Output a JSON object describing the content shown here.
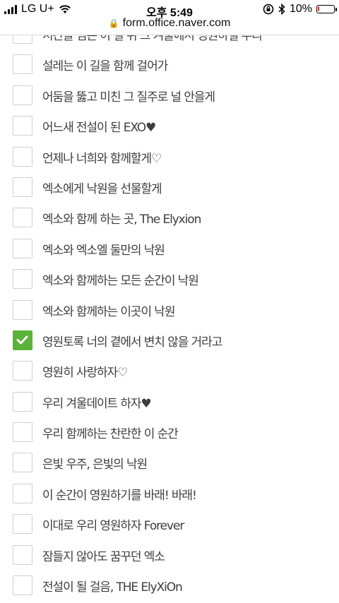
{
  "status_bar": {
    "carrier": "LG U+",
    "time": "오후 5:49",
    "battery_percent": "10%",
    "battery_level": 0.1
  },
  "browser": {
    "url": "form.office.naver.com"
  },
  "options": [
    {
      "label": "시간을 넘은 이 길 위 그 겨울에서 영원하길 우리",
      "checked": false
    },
    {
      "label": "설레는 이 길을 함께 걸어가",
      "checked": false
    },
    {
      "label": "어둠을 뚫고 미친 그 질주로 널 안을게",
      "checked": false
    },
    {
      "label": "어느새 전설이 된 EXO♥",
      "checked": false
    },
    {
      "label": "언제나 너희와 함께할게♡",
      "checked": false
    },
    {
      "label": "엑소에게 낙원을 선물할게",
      "checked": false
    },
    {
      "label": "엑소와 함께 하는 곳, The Elyxion",
      "checked": false
    },
    {
      "label": "엑소와 엑소엘 둘만의 낙원",
      "checked": false
    },
    {
      "label": "엑소와 함께하는 모든 순간이 낙원",
      "checked": false
    },
    {
      "label": "엑소와 함께하는 이곳이 낙원",
      "checked": false
    },
    {
      "label": "영원토록 너의 곁에서 변치 않을 거라고",
      "checked": true
    },
    {
      "label": "영원히 사랑하자♡",
      "checked": false
    },
    {
      "label": "우리 겨울데이트 하자♥",
      "checked": false
    },
    {
      "label": "우리 함께하는 찬란한 이 순간",
      "checked": false
    },
    {
      "label": "은빛 우주, 은빛의 낙원",
      "checked": false
    },
    {
      "label": "이 순간이 영원하기를 바래! 바래!",
      "checked": false
    },
    {
      "label": "이대로 우리 영원하자 Forever",
      "checked": false
    },
    {
      "label": "잠들지 않아도 꿈꾸던 엑소",
      "checked": false
    },
    {
      "label": "전설이 될 걸음, THE ElyXiOn",
      "checked": false
    }
  ],
  "colors": {
    "checked_fill": "#5bb23a",
    "checkbox_border": "#cfcfcf",
    "battery_low": "#e53935"
  }
}
